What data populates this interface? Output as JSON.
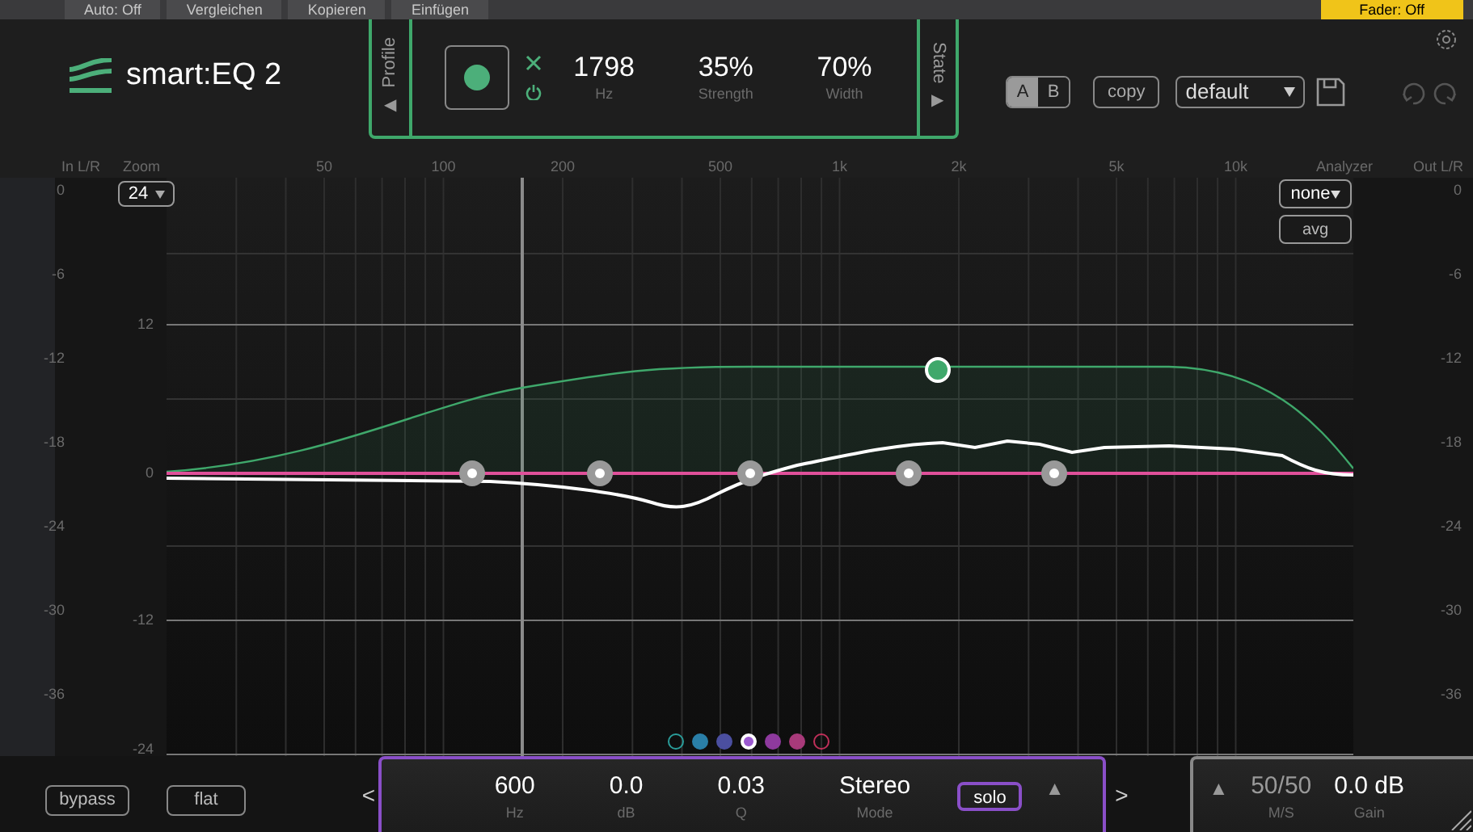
{
  "host_toolbar": {
    "buttons": [
      "Auto: Off",
      "Vergleichen",
      "Kopieren",
      "Einfügen"
    ],
    "fader_button": "Fader: Off"
  },
  "logo": {
    "name": "smart:EQ 2"
  },
  "profile_panel": {
    "profile_tab": "Profile",
    "profile_arrow": "◀",
    "state_tab": "State",
    "state_arrow": "▶",
    "readings": [
      {
        "value": "1798",
        "unit": "Hz"
      },
      {
        "value": "35%",
        "unit": "Strength"
      },
      {
        "value": "70%",
        "unit": "Width"
      }
    ]
  },
  "ab": [
    {
      "label": "A",
      "selected": true
    },
    {
      "label": "B",
      "selected": false
    }
  ],
  "copy_button": "copy",
  "preset": {
    "value": "default"
  },
  "axis": {
    "in_label": "In L/R",
    "zoom_label": "Zoom",
    "zoom_value": "24",
    "analyzer_label": "Analyzer",
    "out_label": "Out L/R",
    "freq_labels": [
      "50",
      "100",
      "200",
      "500",
      "1k",
      "2k",
      "5k",
      "10k"
    ],
    "in_meter_labels": [
      "0",
      "-6",
      "-12",
      "-18",
      "-24",
      "-30",
      "-36"
    ],
    "gain_labels": [
      "12",
      "0",
      "-12",
      "-24"
    ],
    "out_meter_labels": [
      "0",
      "-6",
      "-12",
      "-18",
      "-24",
      "-30",
      "-36"
    ]
  },
  "analyzer": {
    "mode": "none",
    "avg_button": "avg"
  },
  "bands": [
    {
      "color": "#2a9d9a",
      "filled": false,
      "selected": false
    },
    {
      "color": "#2a7fa8",
      "filled": true,
      "selected": false
    },
    {
      "color": "#4b4fa0",
      "filled": true,
      "selected": false
    },
    {
      "color": "#9b59d0",
      "filled": true,
      "selected": true
    },
    {
      "color": "#8e3a9e",
      "filled": true,
      "selected": false
    },
    {
      "color": "#a83a7a",
      "filled": true,
      "selected": false
    },
    {
      "color": "#c0305a",
      "filled": false,
      "selected": false
    }
  ],
  "bypass_button": "bypass",
  "flat_button": "flat",
  "band_panel": {
    "prev": "<",
    "next": ">",
    "solo_button": "solo",
    "expand": "▲",
    "readings": [
      {
        "value": "600",
        "unit": "Hz"
      },
      {
        "value": "0.0",
        "unit": "dB"
      },
      {
        "value": "0.03",
        "unit": "Q"
      },
      {
        "value": "Stereo",
        "unit": "Mode"
      }
    ]
  },
  "output_panel": {
    "expand": "▲",
    "readings": [
      {
        "value": "50/50",
        "unit": "M/S"
      },
      {
        "value": "0.0 dB",
        "unit": "Gain"
      }
    ]
  }
}
